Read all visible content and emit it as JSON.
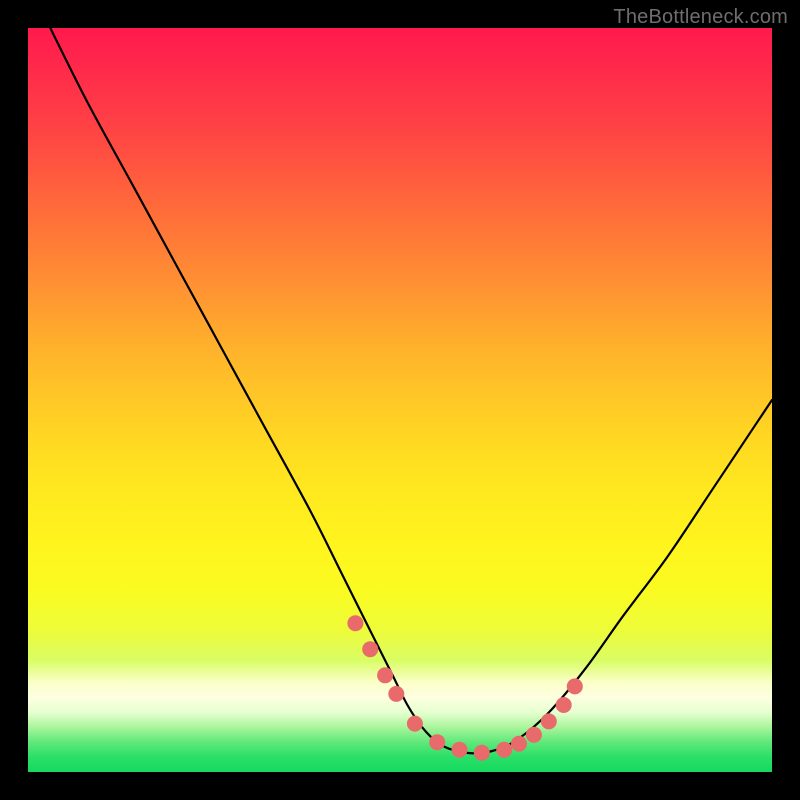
{
  "watermark": "TheBottleneck.com",
  "chart_data": {
    "type": "line",
    "title": "",
    "xlabel": "",
    "ylabel": "",
    "xlim": [
      0,
      100
    ],
    "ylim": [
      0,
      100
    ],
    "grid": false,
    "series": [
      {
        "name": "bottleneck-curve",
        "x": [
          3,
          8,
          14,
          20,
          26,
          32,
          38,
          42,
          46,
          49,
          51,
          53,
          55,
          57,
          60,
          63,
          66,
          70,
          75,
          80,
          86,
          92,
          98,
          100
        ],
        "y": [
          100,
          90,
          79,
          68,
          57,
          46,
          35,
          27,
          19,
          13,
          9,
          6,
          4,
          3,
          2.5,
          3,
          4.5,
          8,
          14,
          21,
          29,
          38,
          47,
          50
        ]
      }
    ],
    "markers": {
      "name": "flat-region-dots",
      "color": "#e96a6a",
      "radius_px": 8,
      "x": [
        44,
        46,
        48,
        49.5,
        52,
        55,
        58,
        61,
        64,
        66,
        68,
        70,
        72,
        73.5
      ],
      "y": [
        20,
        16.5,
        13,
        10.5,
        6.5,
        4,
        3,
        2.6,
        3,
        3.8,
        5,
        6.8,
        9,
        11.5
      ]
    }
  }
}
